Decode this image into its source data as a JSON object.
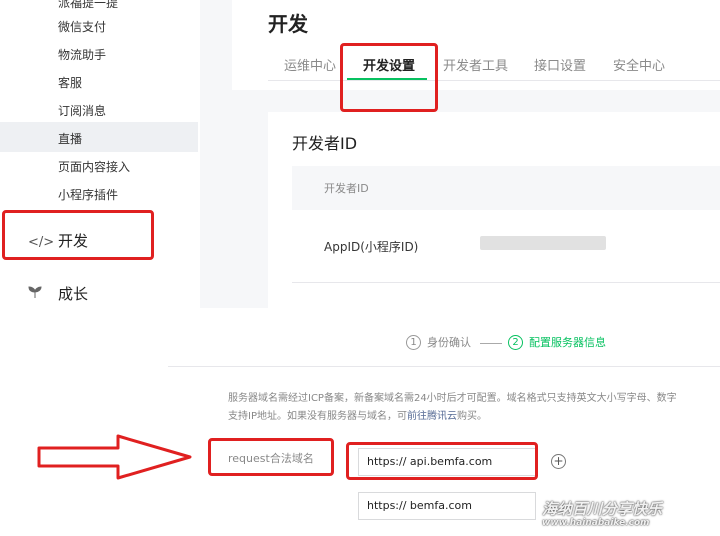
{
  "sidebar": {
    "items": [
      {
        "label": "派福提一提"
      },
      {
        "label": "微信支付"
      },
      {
        "label": "物流助手"
      },
      {
        "label": "客服"
      },
      {
        "label": "订阅消息"
      },
      {
        "label": "直播"
      },
      {
        "label": "页面内容接入"
      },
      {
        "label": "小程序插件"
      }
    ],
    "group_dev": {
      "label": "开发",
      "icon": "code-icon"
    },
    "group_growth": {
      "label": "成长",
      "icon": "sprout-icon"
    }
  },
  "main": {
    "title": "开发",
    "tabs": [
      {
        "label": "运维中心"
      },
      {
        "label": "开发设置"
      },
      {
        "label": "开发者工具"
      },
      {
        "label": "接口设置"
      },
      {
        "label": "安全中心"
      }
    ],
    "card": {
      "title": "开发者ID",
      "header": "开发者ID",
      "appid_label": "AppID(小程序ID)"
    }
  },
  "server_config": {
    "steps": [
      {
        "num": "1",
        "label": "身份确认"
      },
      {
        "num": "2",
        "label": "配置服务器信息"
      }
    ],
    "notice_line1": "服务器域名需经过ICP备案，新备案域名需24小时后才可配置。域名格式只支持英文大小写字母、数字",
    "notice_line2_prefix": "支持IP地址。如果没有服务器与域名，可",
    "notice_link": "前往腾讯云",
    "notice_line2_suffix": "购买。",
    "request_label": "request合法域名",
    "domains": [
      "https:// api.bemfa.com",
      "https:// bemfa.com"
    ],
    "add_icon": "plus-circle-icon"
  },
  "watermark": {
    "line1": "海纳百川分享快乐",
    "line2": "www.hainabaike.com"
  },
  "colors": {
    "accent": "#07c160",
    "highlight": "#e02020",
    "link": "#576b95"
  }
}
